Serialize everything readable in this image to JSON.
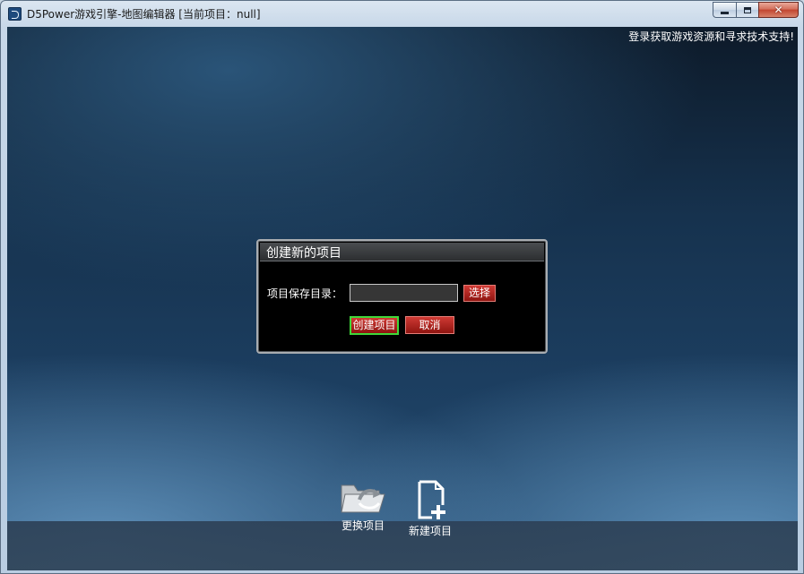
{
  "window": {
    "title": "D5Power游戏引擎-地图编辑器 [当前项目：null]",
    "controls": {
      "minimize": "minimize",
      "maximize": "maximize",
      "close": "✕"
    }
  },
  "header": {
    "support_link": "登录获取游戏资源和寻求技术支持!"
  },
  "dialog": {
    "title": "创建新的项目",
    "path_label": "项目保存目录：",
    "path_value": "",
    "browse_label": "选择",
    "create_label": "创建项目",
    "cancel_label": "取消"
  },
  "dock": {
    "items": [
      {
        "label": "更换项目",
        "icon": "open-folder-icon"
      },
      {
        "label": "新建项目",
        "icon": "new-document-icon"
      }
    ]
  },
  "colors": {
    "accent_red": "#b1231e",
    "accent_green": "#3fd83a",
    "background_top": "#0d1a29",
    "background_bottom": "#244b70"
  }
}
